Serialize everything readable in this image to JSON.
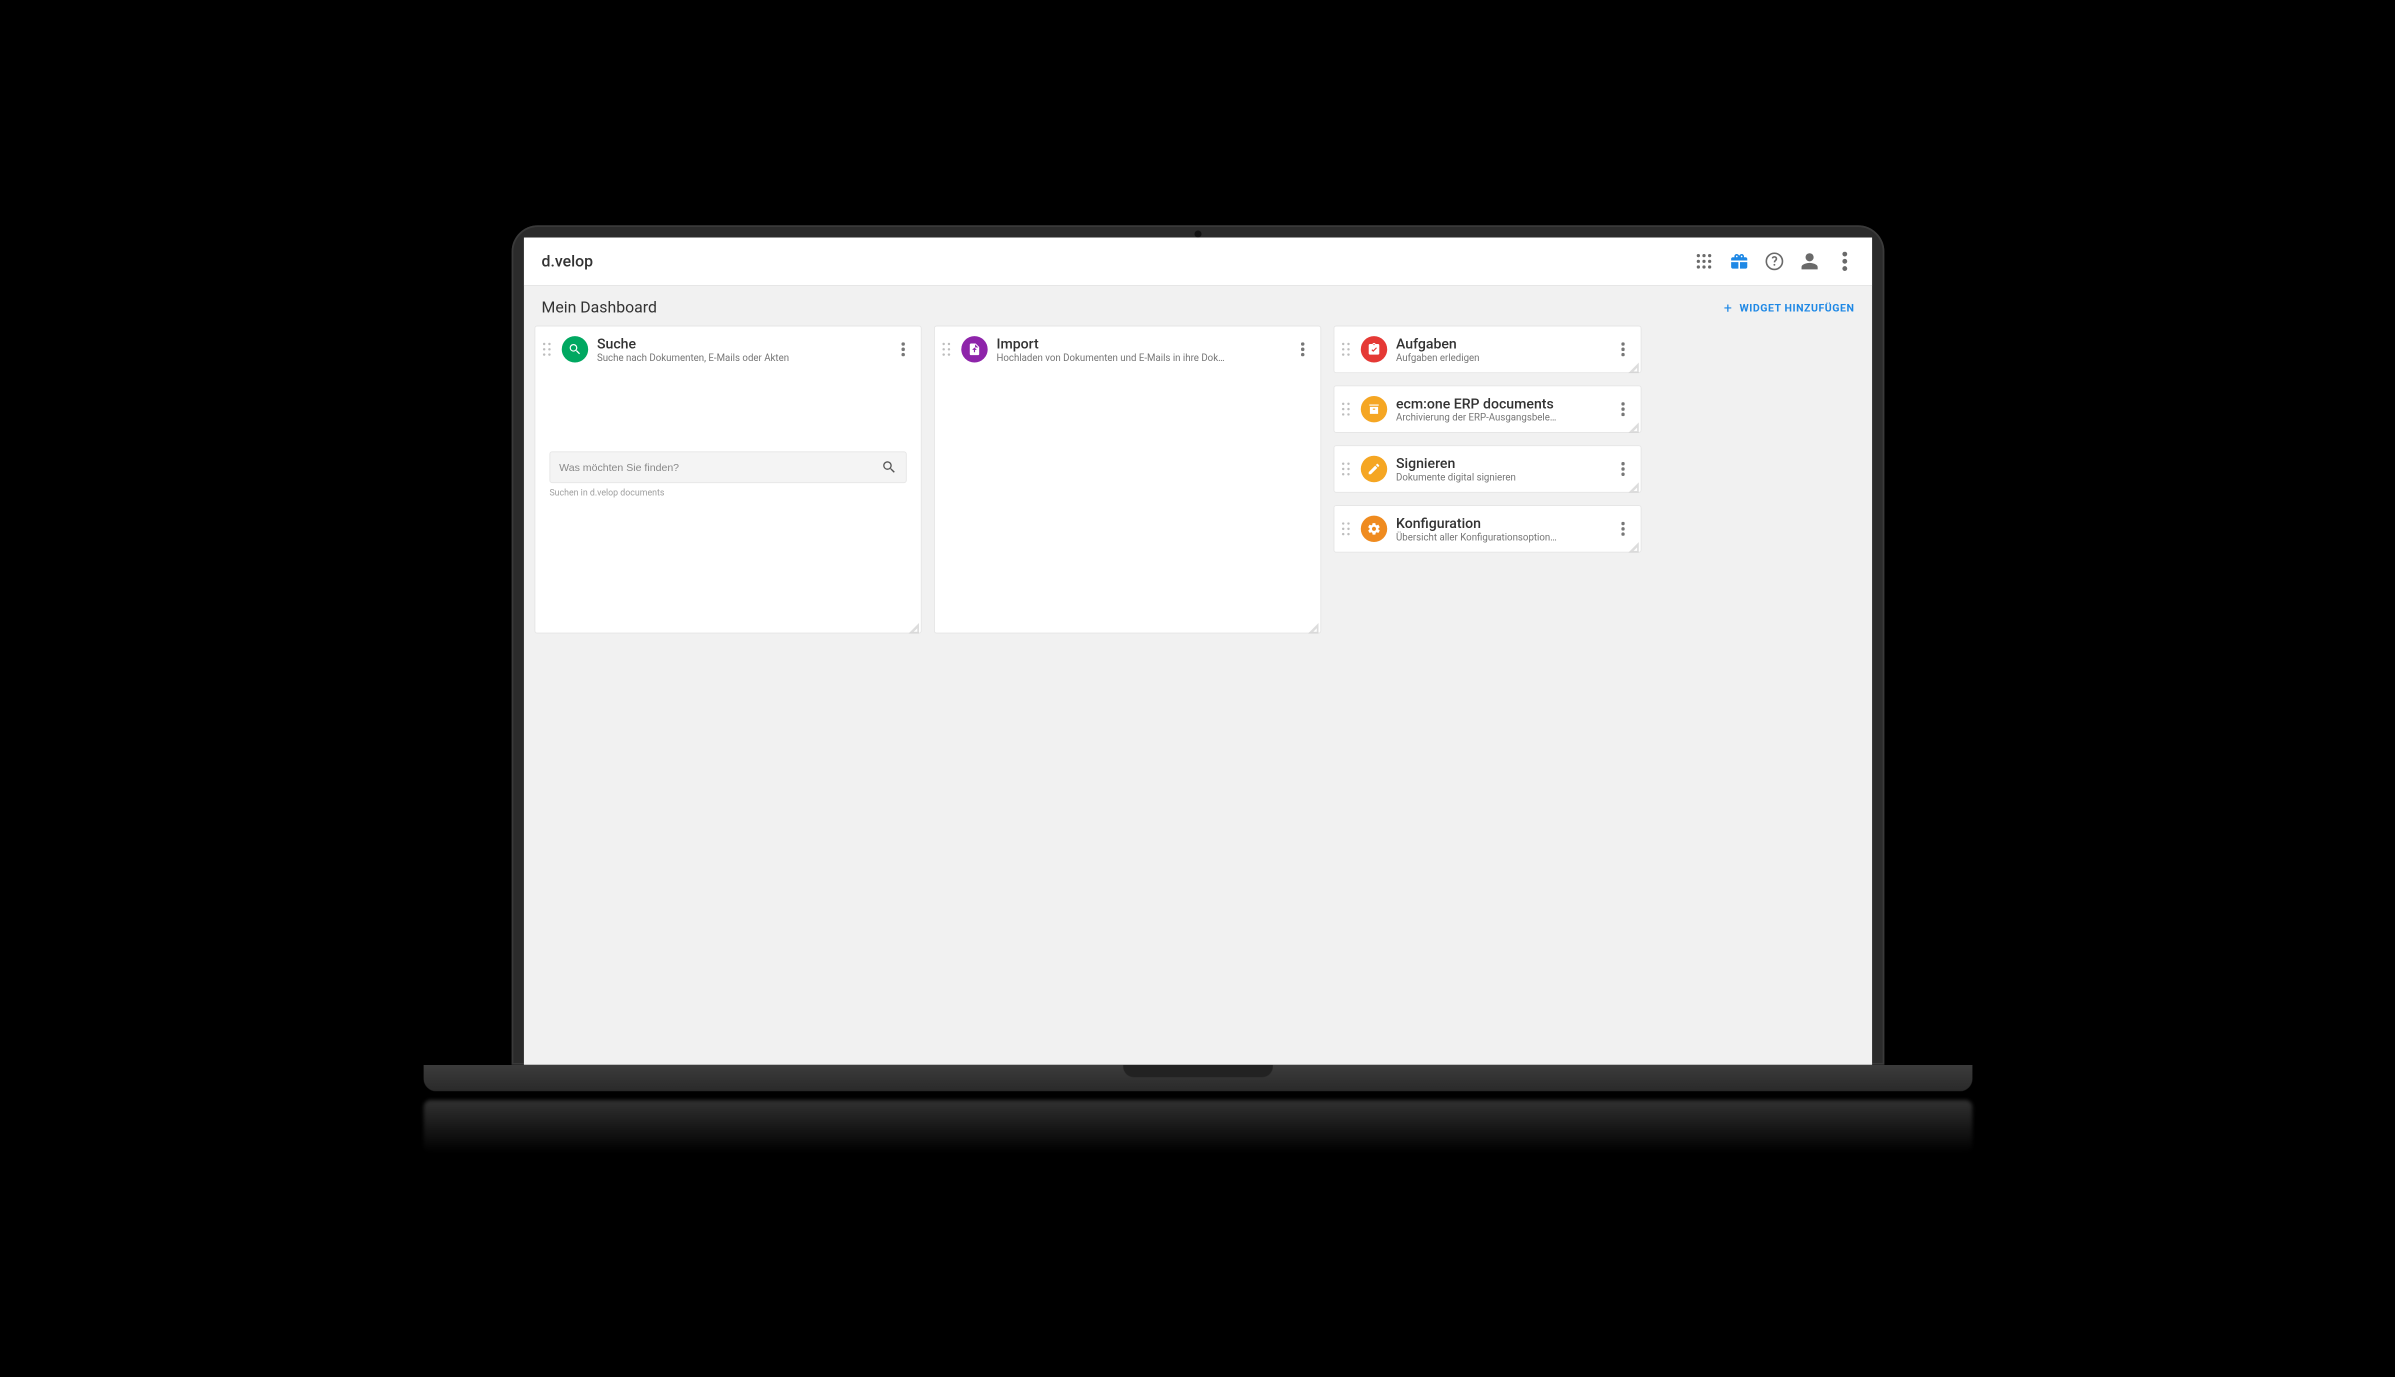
{
  "brand": "d.velop",
  "dashboard": {
    "title": "Mein Dashboard",
    "add_widget_label": "WIDGET HINZUFÜGEN"
  },
  "widgets": {
    "search": {
      "title": "Suche",
      "subtitle": "Suche nach Dokumenten, E-Mails oder Akten",
      "placeholder": "Was möchten Sie finden?",
      "hint": "Suchen in d.velop documents"
    },
    "import": {
      "title": "Import",
      "subtitle": "Hochladen von Dokumenten und E-Mails in ihre Dok…"
    },
    "tasks": {
      "title": "Aufgaben",
      "subtitle": "Aufgaben erledigen"
    },
    "erp": {
      "title": "ecm:one ERP documents",
      "subtitle": "Archivierung der ERP-Ausgangsbele…"
    },
    "sign": {
      "title": "Signieren",
      "subtitle": "Dokumente digital signieren"
    },
    "config": {
      "title": "Konfiguration",
      "subtitle": "Übersicht aller Konfigurationsoption…"
    }
  }
}
